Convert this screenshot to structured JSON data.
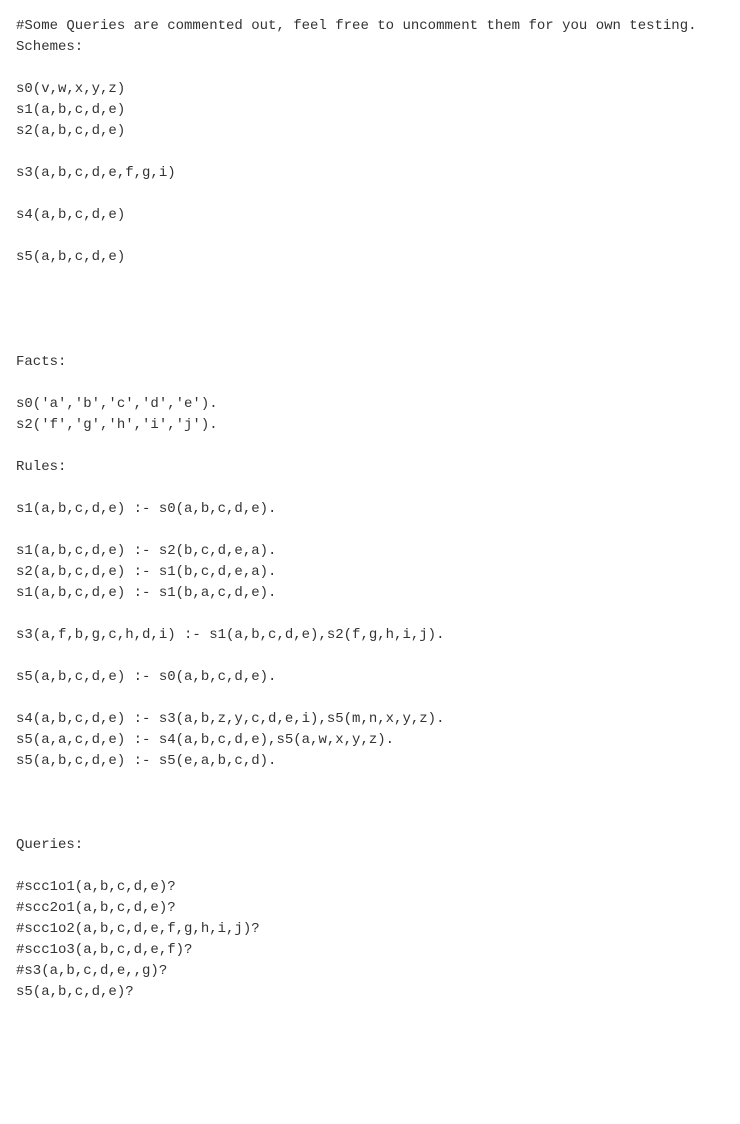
{
  "lines": [
    "#Some Queries are commented out, feel free to uncomment them for you own testing.",
    "Schemes:",
    "",
    "s0(v,w,x,y,z)",
    "s1(a,b,c,d,e)",
    "s2(a,b,c,d,e)",
    "",
    "s3(a,b,c,d,e,f,g,i)",
    "",
    "s4(a,b,c,d,e)",
    "",
    "s5(a,b,c,d,e)",
    "",
    "",
    "",
    "",
    "Facts:",
    "",
    "s0('a','b','c','d','e').",
    "s2('f','g','h','i','j').",
    "",
    "Rules:",
    "",
    "s1(a,b,c,d,e) :- s0(a,b,c,d,e).",
    "",
    "s1(a,b,c,d,e) :- s2(b,c,d,e,a).",
    "s2(a,b,c,d,e) :- s1(b,c,d,e,a).",
    "s1(a,b,c,d,e) :- s1(b,a,c,d,e).",
    "",
    "s3(a,f,b,g,c,h,d,i) :- s1(a,b,c,d,e),s2(f,g,h,i,j).",
    "",
    "s5(a,b,c,d,e) :- s0(a,b,c,d,e).",
    "",
    "s4(a,b,c,d,e) :- s3(a,b,z,y,c,d,e,i),s5(m,n,x,y,z).",
    "s5(a,a,c,d,e) :- s4(a,b,c,d,e),s5(a,w,x,y,z).",
    "s5(a,b,c,d,e) :- s5(e,a,b,c,d).",
    "",
    "",
    "",
    "Queries:",
    "",
    "#scc1o1(a,b,c,d,e)?",
    "#scc2o1(a,b,c,d,e)?",
    "#scc1o2(a,b,c,d,e,f,g,h,i,j)?",
    "#scc1o3(a,b,c,d,e,f)?",
    "#s3(a,b,c,d,e,,g)?",
    "s5(a,b,c,d,e)?",
    "",
    ""
  ]
}
